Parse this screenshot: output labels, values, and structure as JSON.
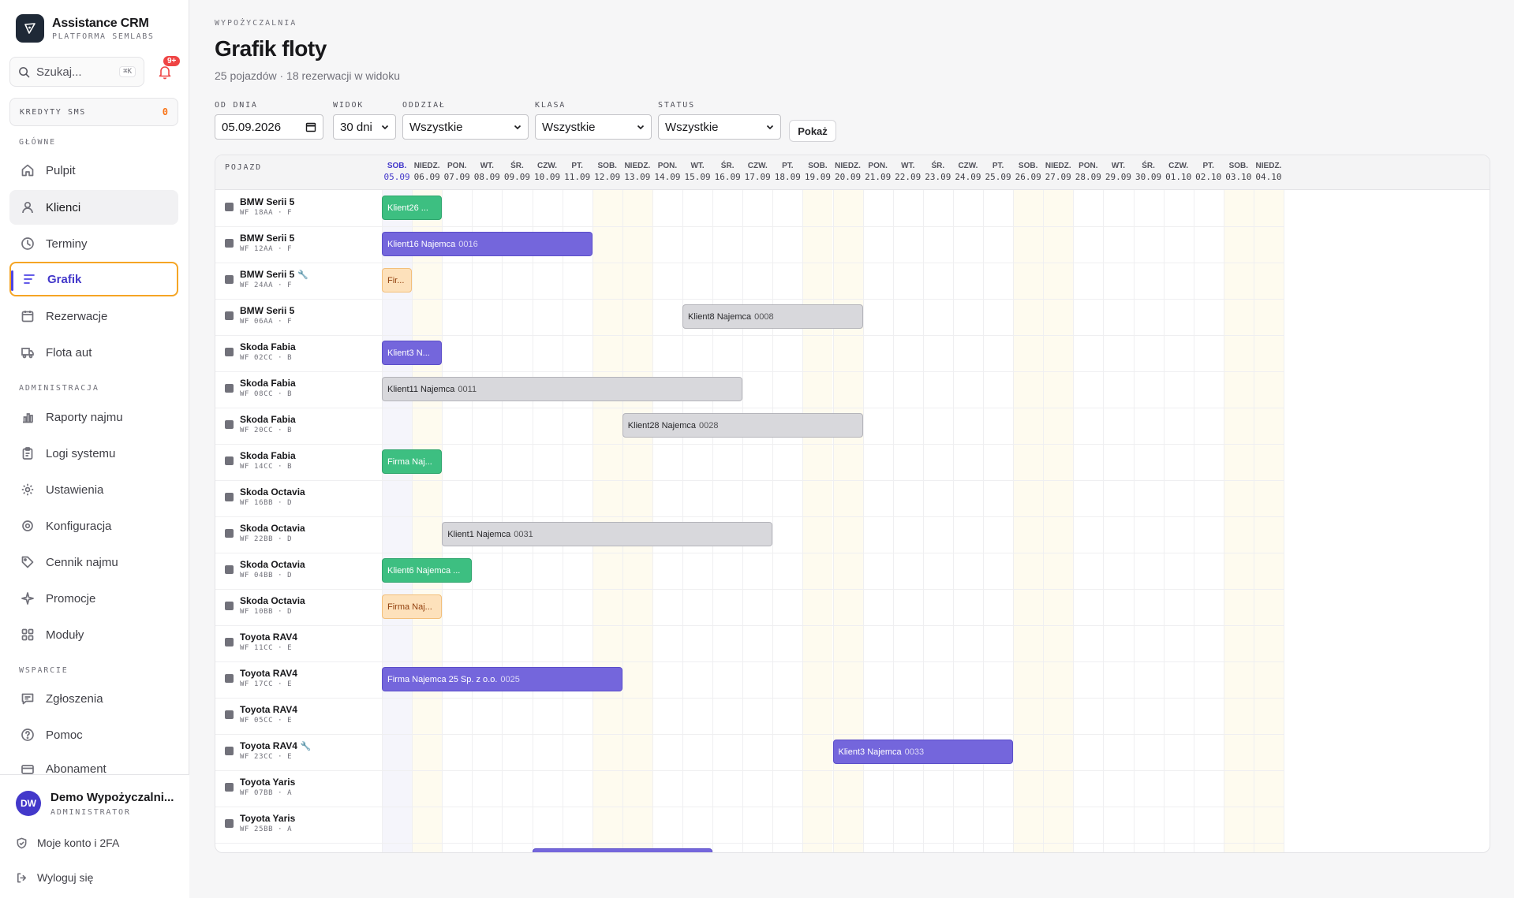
{
  "brand": {
    "title": "Assistance CRM",
    "subtitle": "PLATFORMA SEMLABS"
  },
  "search": {
    "placeholder": "Szukaj...",
    "shortcut": "⌘K"
  },
  "notifications": {
    "badge": "9+"
  },
  "sms": {
    "label": "KREDYTY SMS",
    "value": "0"
  },
  "nav": {
    "section_main": "GŁÓWNE",
    "main": [
      {
        "label": "Pulpit",
        "icon": "home-icon"
      },
      {
        "label": "Klienci",
        "icon": "user-icon"
      },
      {
        "label": "Terminy",
        "icon": "clock-icon"
      },
      {
        "label": "Grafik",
        "icon": "gantt-icon"
      },
      {
        "label": "Rezerwacje",
        "icon": "calendar-icon"
      },
      {
        "label": "Flota aut",
        "icon": "truck-icon"
      }
    ],
    "section_admin": "ADMINISTRACJA",
    "admin": [
      {
        "label": "Raporty najmu",
        "icon": "chart-icon"
      },
      {
        "label": "Logi systemu",
        "icon": "clipboard-icon"
      },
      {
        "label": "Ustawienia",
        "icon": "gear-icon"
      },
      {
        "label": "Konfiguracja",
        "icon": "cog-icon"
      },
      {
        "label": "Cennik najmu",
        "icon": "tag-icon"
      },
      {
        "label": "Promocje",
        "icon": "sparkle-icon"
      },
      {
        "label": "Moduły",
        "icon": "grid-icon"
      }
    ],
    "section_support": "WSPARCIE",
    "support": [
      {
        "label": "Zgłoszenia",
        "icon": "message-icon"
      },
      {
        "label": "Pomoc",
        "icon": "help-icon"
      },
      {
        "label": "Abonament",
        "icon": "card-icon"
      }
    ]
  },
  "user": {
    "initials": "DW",
    "name": "Demo Wypożyczalni...",
    "role": "ADMINISTRATOR"
  },
  "footer": {
    "account": "Moje konto i 2FA",
    "logout": "Wyloguj się"
  },
  "page": {
    "eyebrow": "WYPOŻYCZALNIA",
    "title": "Grafik floty",
    "subtitle": "25 pojazdów · 18 rezerwacji w widoku"
  },
  "filters": {
    "from_label": "OD DNIA",
    "from_value": "05.09.2026",
    "view_label": "WIDOK",
    "view_value": "30 dni",
    "branch_label": "ODDZIAŁ",
    "branch_value": "Wszystkie",
    "class_label": "KLASA",
    "class_value": "Wszystkie",
    "status_label": "STATUS",
    "status_value": "Wszystkie",
    "show_button": "Pokaż"
  },
  "gantt": {
    "vehicle_header": "POJAZD",
    "days": [
      {
        "n": "SOB.",
        "d": "05.09"
      },
      {
        "n": "NIEDZ.",
        "d": "06.09"
      },
      {
        "n": "PON.",
        "d": "07.09"
      },
      {
        "n": "WT.",
        "d": "08.09"
      },
      {
        "n": "ŚR.",
        "d": "09.09"
      },
      {
        "n": "CZW.",
        "d": "10.09"
      },
      {
        "n": "PT.",
        "d": "11.09"
      },
      {
        "n": "SOB.",
        "d": "12.09"
      },
      {
        "n": "NIEDZ.",
        "d": "13.09"
      },
      {
        "n": "PON.",
        "d": "14.09"
      },
      {
        "n": "WT.",
        "d": "15.09"
      },
      {
        "n": "ŚR.",
        "d": "16.09"
      },
      {
        "n": "CZW.",
        "d": "17.09"
      },
      {
        "n": "PT.",
        "d": "18.09"
      },
      {
        "n": "SOB.",
        "d": "19.09"
      },
      {
        "n": "NIEDZ.",
        "d": "20.09"
      },
      {
        "n": "PON.",
        "d": "21.09"
      },
      {
        "n": "WT.",
        "d": "22.09"
      },
      {
        "n": "ŚR.",
        "d": "23.09"
      },
      {
        "n": "CZW.",
        "d": "24.09"
      },
      {
        "n": "PT.",
        "d": "25.09"
      },
      {
        "n": "SOB.",
        "d": "26.09"
      },
      {
        "n": "NIEDZ.",
        "d": "27.09"
      },
      {
        "n": "PON.",
        "d": "28.09"
      },
      {
        "n": "WT.",
        "d": "29.09"
      },
      {
        "n": "ŚR.",
        "d": "30.09"
      },
      {
        "n": "CZW.",
        "d": "01.10"
      },
      {
        "n": "PT.",
        "d": "02.10"
      },
      {
        "n": "SOB.",
        "d": "03.10"
      },
      {
        "n": "NIEDZ.",
        "d": "04.10"
      }
    ],
    "vehicles": [
      {
        "name": "BMW Serii 5",
        "plate": "WF 18AA · F",
        "wrench": false
      },
      {
        "name": "BMW Serii 5",
        "plate": "WF 12AA · F",
        "wrench": false
      },
      {
        "name": "BMW Serii 5",
        "plate": "WF 24AA · F",
        "wrench": true
      },
      {
        "name": "BMW Serii 5",
        "plate": "WF 06AA · F",
        "wrench": false
      },
      {
        "name": "Skoda Fabia",
        "plate": "WF 02CC · B",
        "wrench": false
      },
      {
        "name": "Skoda Fabia",
        "plate": "WF 08CC · B",
        "wrench": false
      },
      {
        "name": "Skoda Fabia",
        "plate": "WF 20CC · B",
        "wrench": false
      },
      {
        "name": "Skoda Fabia",
        "plate": "WF 14CC · B",
        "wrench": false
      },
      {
        "name": "Skoda Octavia",
        "plate": "WF 16BB · D",
        "wrench": false
      },
      {
        "name": "Skoda Octavia",
        "plate": "WF 22BB · D",
        "wrench": false
      },
      {
        "name": "Skoda Octavia",
        "plate": "WF 04BB · D",
        "wrench": false
      },
      {
        "name": "Skoda Octavia",
        "plate": "WF 10BB · D",
        "wrench": false
      },
      {
        "name": "Toyota RAV4",
        "plate": "WF 11CC · E",
        "wrench": false
      },
      {
        "name": "Toyota RAV4",
        "plate": "WF 17CC · E",
        "wrench": false
      },
      {
        "name": "Toyota RAV4",
        "plate": "WF 05CC · E",
        "wrench": false
      },
      {
        "name": "Toyota RAV4",
        "plate": "WF 23CC · E",
        "wrench": true
      },
      {
        "name": "Toyota Yaris",
        "plate": "WF 07BB · A",
        "wrench": false
      },
      {
        "name": "Toyota Yaris",
        "plate": "WF 25BB · A",
        "wrench": false
      }
    ],
    "bookings": [
      {
        "row": 0,
        "start": 0,
        "days": 2,
        "color": "green",
        "label": "Klient26 ...",
        "code": "",
        "dashed": false
      },
      {
        "row": 1,
        "start": 0,
        "days": 7,
        "color": "purple",
        "label": "Klient16 Najemca",
        "code": "0016",
        "dashed": false
      },
      {
        "row": 2,
        "start": 0,
        "days": 1,
        "color": "peach",
        "label": "Fir...",
        "code": "",
        "dashed": false
      },
      {
        "row": 3,
        "start": 10,
        "days": 6,
        "color": "gray",
        "label": "Klient8 Najemca",
        "code": "0008",
        "dashed": false
      },
      {
        "row": 4,
        "start": 0,
        "days": 2,
        "color": "purple",
        "label": "Klient3 N...",
        "code": "",
        "dashed": true
      },
      {
        "row": 5,
        "start": 0,
        "days": 12,
        "color": "gray",
        "label": "Klient11 Najemca",
        "code": "0011",
        "dashed": false
      },
      {
        "row": 6,
        "start": 8,
        "days": 8,
        "color": "gray",
        "label": "Klient28 Najemca",
        "code": "0028",
        "dashed": false
      },
      {
        "row": 7,
        "start": 0,
        "days": 2,
        "color": "green",
        "label": "Firma Naj...",
        "code": "",
        "dashed": false
      },
      {
        "row": 9,
        "start": 2,
        "days": 11,
        "color": "gray",
        "label": "Klient1 Najemca",
        "code": "0031",
        "dashed": false
      },
      {
        "row": 10,
        "start": 0,
        "days": 3,
        "color": "green",
        "label": "Klient6 Najemca ...",
        "code": "",
        "dashed": true
      },
      {
        "row": 11,
        "start": 0,
        "days": 2,
        "color": "peach",
        "label": "Firma Naj...",
        "code": "",
        "dashed": false
      },
      {
        "row": 13,
        "start": 0,
        "days": 8,
        "color": "purple",
        "label": "Firma Najemca 25 Sp. z o.o.",
        "code": "0025",
        "dashed": false
      },
      {
        "row": 15,
        "start": 15,
        "days": 6,
        "color": "purple",
        "label": "Klient3 Najemca",
        "code": "0033",
        "dashed": false
      },
      {
        "row": 18,
        "start": 5,
        "days": 6,
        "color": "purple",
        "label": "",
        "code": "",
        "dashed": false
      }
    ]
  }
}
